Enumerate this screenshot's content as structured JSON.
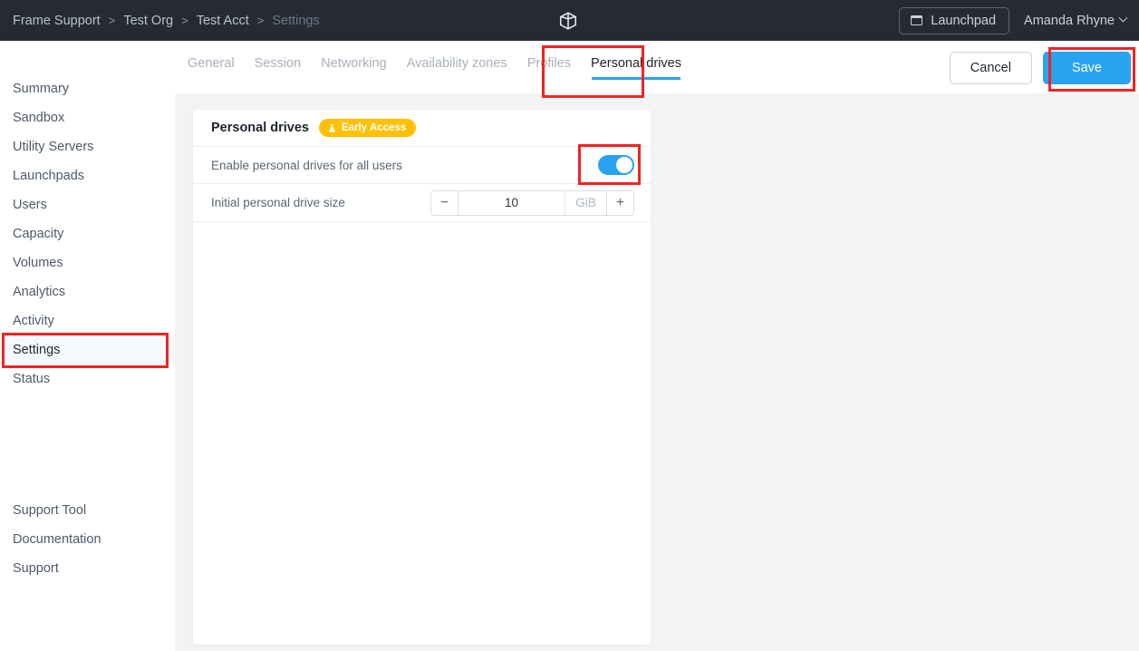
{
  "topbar": {
    "breadcrumb": [
      {
        "label": "Frame Support",
        "dim": false
      },
      {
        "label": "Test Org",
        "dim": false
      },
      {
        "label": "Test Acct",
        "dim": false
      },
      {
        "label": "Settings",
        "dim": true
      }
    ],
    "separator": ">",
    "logo_icon": "cube-logo-icon",
    "launchpad_label": "Launchpad",
    "launchpad_icon": "window-icon",
    "user_name": "Amanda Rhyne",
    "user_chevron_icon": "chevron-down-icon",
    "background_color": "#252a33"
  },
  "sidebar": {
    "top_items": [
      {
        "label": "Summary",
        "active": false
      },
      {
        "label": "Sandbox",
        "active": false
      },
      {
        "label": "Utility Servers",
        "active": false
      },
      {
        "label": "Launchpads",
        "active": false
      },
      {
        "label": "Users",
        "active": false
      },
      {
        "label": "Capacity",
        "active": false
      },
      {
        "label": "Volumes",
        "active": false
      },
      {
        "label": "Analytics",
        "active": false
      },
      {
        "label": "Activity",
        "active": false
      },
      {
        "label": "Settings",
        "active": true
      },
      {
        "label": "Status",
        "active": false
      }
    ],
    "bottom_items": [
      {
        "label": "Support Tool"
      },
      {
        "label": "Documentation"
      },
      {
        "label": "Support"
      }
    ],
    "active_indicator_color": "#29a3f0"
  },
  "subheader": {
    "tabs": [
      {
        "label": "General",
        "active": false
      },
      {
        "label": "Session",
        "active": false
      },
      {
        "label": "Networking",
        "active": false
      },
      {
        "label": "Availability zones",
        "active": false
      },
      {
        "label": "Profiles",
        "active": false
      },
      {
        "label": "Personal drives",
        "active": true
      }
    ],
    "cancel_label": "Cancel",
    "save_label": "Save",
    "save_color": "#29a3f0"
  },
  "card": {
    "title": "Personal drives",
    "badge": {
      "label": "Early Access",
      "icon": "flask-icon",
      "color": "#ffc107"
    },
    "rows": [
      {
        "label": "Enable personal drives for all users",
        "control": "toggle",
        "value": "on",
        "toggle_color": "#29a3f0"
      },
      {
        "label": "Initial personal drive size",
        "control": "stepper",
        "value": "10",
        "unit": "GiB",
        "minus_label": "−",
        "plus_label": "+"
      }
    ]
  },
  "annotations": {
    "color": "#f52222",
    "boxes": [
      {
        "target": "sidebar-item-settings"
      },
      {
        "target": "tab-personal-drives"
      },
      {
        "target": "save-button"
      },
      {
        "target": "enable-personal-drives-toggle"
      }
    ]
  }
}
